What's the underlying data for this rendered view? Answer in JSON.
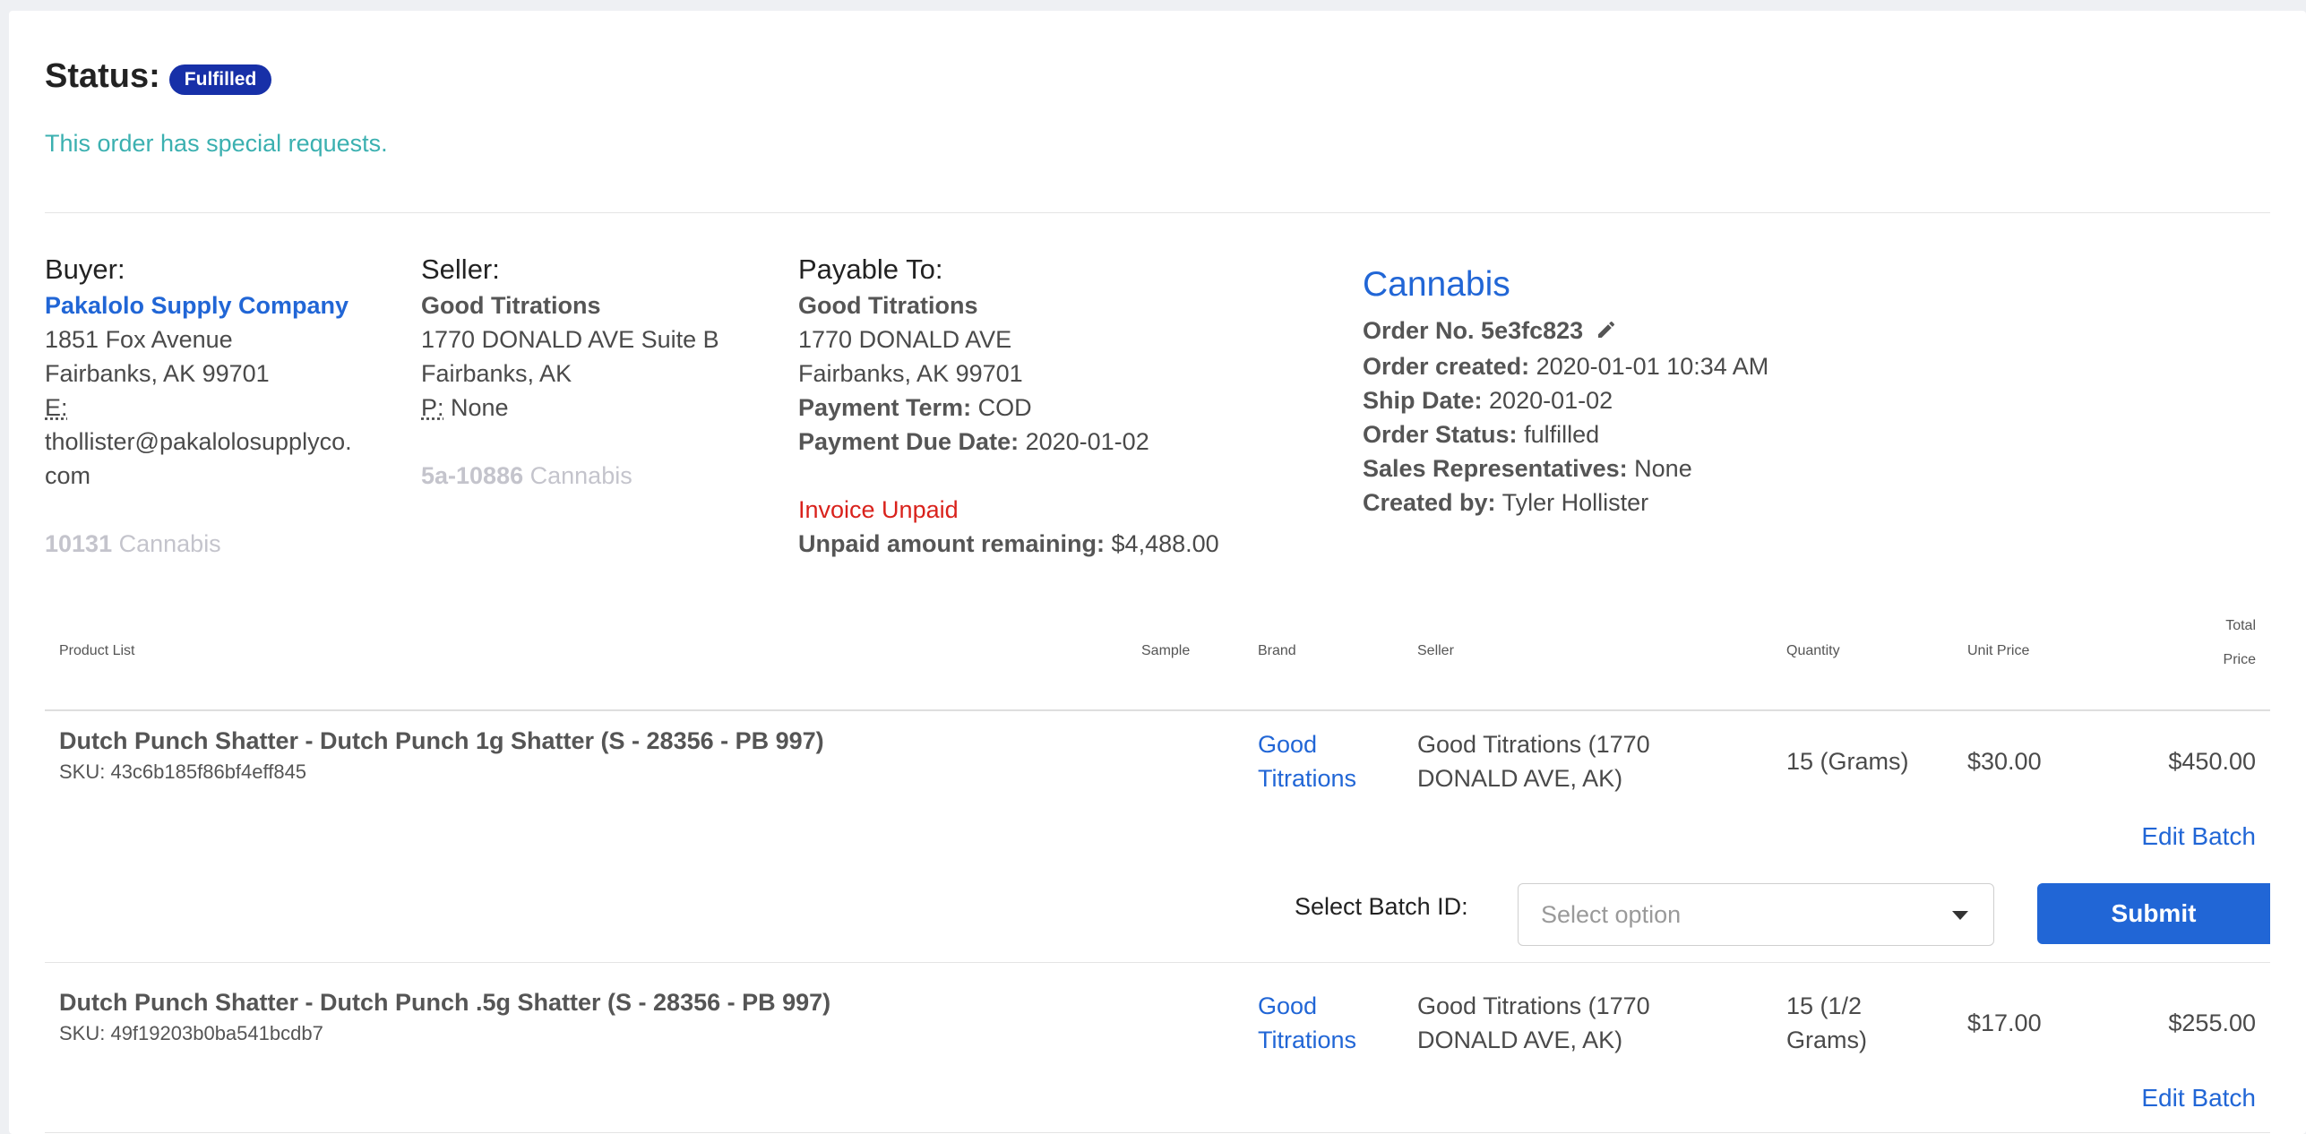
{
  "status": {
    "label": "Status:",
    "badge": "Fulfilled",
    "special_requests": "This order has special requests."
  },
  "buyer": {
    "heading": "Buyer:",
    "name": "Pakalolo Supply Company",
    "address1": "1851 Fox Avenue",
    "address2": "Fairbanks, AK 99701",
    "email_label": "E:",
    "email_line1": "thollister@pakalolosupplyco.",
    "email_line2": "com",
    "license_number": "10131",
    "license_type": "Cannabis"
  },
  "seller": {
    "heading": "Seller:",
    "name": "Good Titrations",
    "address1": "1770 DONALD AVE Suite B",
    "address2": "Fairbanks, AK",
    "phone_label": "P:",
    "phone_value": "None",
    "license_number": "5a-10886",
    "license_type": "Cannabis"
  },
  "payable": {
    "heading": "Payable To:",
    "name": "Good Titrations",
    "address1": "1770 DONALD AVE",
    "address2": "Fairbanks, AK 99701",
    "term_label": "Payment Term:",
    "term_value": "COD",
    "due_label": "Payment Due Date:",
    "due_value": "2020-01-02",
    "invoice_status": "Invoice Unpaid",
    "unpaid_label": "Unpaid amount remaining:",
    "unpaid_value": "$4,488.00"
  },
  "order": {
    "title": "Cannabis",
    "number_label": "Order No.",
    "number_value": "5e3fc823",
    "created_label": "Order created:",
    "created_value": "2020-01-01 10:34 AM",
    "ship_label": "Ship Date:",
    "ship_value": "2020-01-02",
    "status_label": "Order Status:",
    "status_value": "fulfilled",
    "reps_label": "Sales Representatives:",
    "reps_value": "None",
    "created_by_label": "Created by:",
    "created_by_value": "Tyler Hollister"
  },
  "table": {
    "headers": {
      "product": "Product List",
      "sample": "Sample",
      "brand": "Brand",
      "seller": "Seller",
      "quantity": "Quantity",
      "unit_price": "Unit Price",
      "total_price_1": "Total",
      "total_price_2": "Price"
    },
    "rows": [
      {
        "name": "Dutch Punch Shatter - Dutch Punch 1g Shatter (S - 28356 - PB 997)",
        "sku": "SKU: 43c6b185f86bf4eff845",
        "brand_1": "Good",
        "brand_2": "Titrations",
        "seller_1": "Good Titrations (1770",
        "seller_2": "DONALD AVE, AK)",
        "quantity_1": "15 (Grams)",
        "quantity_2": "",
        "unit_price": "$30.00",
        "total_price": "$450.00",
        "edit_label": "Edit Batch"
      },
      {
        "name": "Dutch Punch Shatter - Dutch Punch .5g Shatter (S - 28356 - PB 997)",
        "sku": "SKU: 49f19203b0ba541bcdb7",
        "brand_1": "Good",
        "brand_2": "Titrations",
        "seller_1": "Good Titrations (1770",
        "seller_2": "DONALD AVE, AK)",
        "quantity_1": "15 (1/2",
        "quantity_2": "Grams)",
        "unit_price": "$17.00",
        "total_price": "$255.00",
        "edit_label": "Edit Batch"
      }
    ],
    "batch": {
      "label": "Select Batch ID:",
      "placeholder": "Select option",
      "submit_label": "Submit"
    }
  },
  "colors": {
    "accent": "#2166d6",
    "badge": "#1730a8",
    "special": "#3bb0b0",
    "unpaid": "#d9221c"
  }
}
